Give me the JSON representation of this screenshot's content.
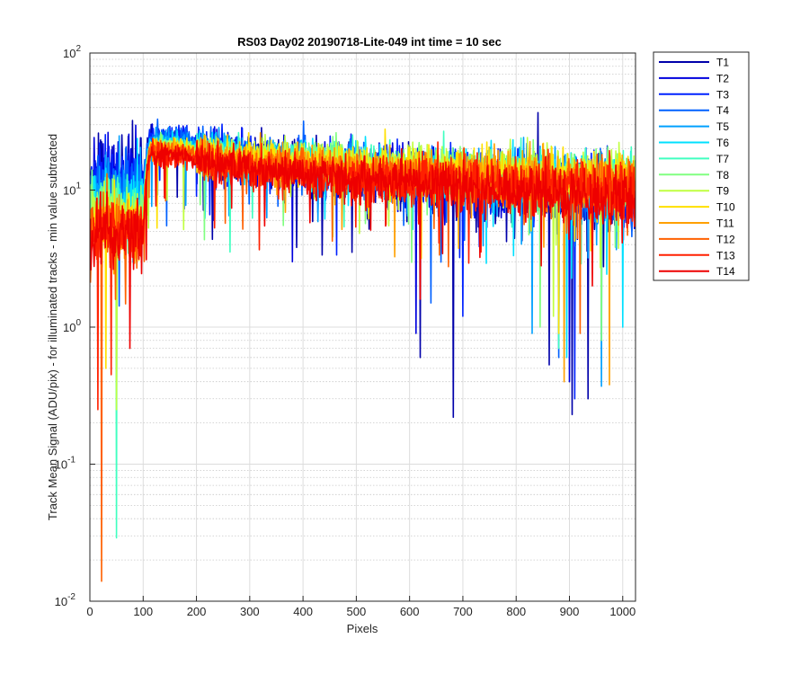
{
  "chart_data": {
    "type": "line",
    "title": "RS03 Day02 20190718-Lite-049 int time = 10 sec",
    "xlabel": "Pixels",
    "ylabel": "Track Mean Signal (ADU/pix) - for illuminated tracks - min value subtracted",
    "xlim": [
      0,
      1024
    ],
    "ylim": [
      0.01,
      100
    ],
    "yscale": "log",
    "x_ticks": [
      "0",
      "100",
      "200",
      "300",
      "400",
      "500",
      "600",
      "700",
      "800",
      "900",
      "1000"
    ],
    "y_ticks": [
      {
        "base": "10",
        "exp": "-2"
      },
      {
        "base": "10",
        "exp": "-1"
      },
      {
        "base": "10",
        "exp": "0"
      },
      {
        "base": "10",
        "exp": "1"
      },
      {
        "base": "10",
        "exp": "2"
      }
    ],
    "grid": true,
    "minor_grid": true,
    "legend_position": "outside-right",
    "series": [
      {
        "name": "T1",
        "color": "#0000aa",
        "profile": {
          "start": 11,
          "edge": 22,
          "mid": 12,
          "end": 8.5
        },
        "noise": 0.45,
        "dips": [
          [
            620,
            0.6
          ],
          [
            682,
            0.22
          ],
          [
            862,
            0.53
          ],
          [
            905,
            0.23
          ],
          [
            935,
            0.3
          ]
        ]
      },
      {
        "name": "T2",
        "color": "#0000dd",
        "profile": {
          "start": 12,
          "edge": 23,
          "mid": 13,
          "end": 9.0
        },
        "noise": 0.42,
        "dips": [
          [
            380,
            3.0
          ],
          [
            612,
            0.9
          ],
          [
            900,
            0.4
          ]
        ]
      },
      {
        "name": "T3",
        "color": "#0022ff",
        "profile": {
          "start": 11,
          "edge": 24,
          "mid": 14,
          "end": 9.5
        },
        "noise": 0.4,
        "dips": [
          [
            910,
            0.3
          ],
          [
            700,
            1.2
          ]
        ]
      },
      {
        "name": "T4",
        "color": "#0060ff",
        "profile": {
          "start": 10,
          "edge": 24,
          "mid": 15,
          "end": 10
        },
        "noise": 0.38,
        "dips": [
          [
            880,
            0.6
          ],
          [
            640,
            1.5
          ]
        ]
      },
      {
        "name": "T5",
        "color": "#00a0ff",
        "profile": {
          "start": 9,
          "edge": 23,
          "mid": 16,
          "end": 10.5
        },
        "noise": 0.36,
        "dips": [
          [
            960,
            0.37
          ],
          [
            830,
            0.9
          ]
        ]
      },
      {
        "name": "T6",
        "color": "#00e0ff",
        "profile": {
          "start": 8,
          "edge": 22,
          "mid": 17,
          "end": 11
        },
        "noise": 0.34,
        "dips": [
          [
            895,
            0.6
          ],
          [
            1000,
            1.0
          ]
        ]
      },
      {
        "name": "T7",
        "color": "#40ffc0",
        "profile": {
          "start": 7,
          "edge": 21,
          "mid": 17,
          "end": 11.5
        },
        "noise": 0.33,
        "dips": [
          [
            880,
            0.7
          ],
          [
            50,
            0.029
          ]
        ]
      },
      {
        "name": "T8",
        "color": "#80ff80",
        "profile": {
          "start": 7,
          "edge": 21,
          "mid": 17,
          "end": 12
        },
        "noise": 0.32,
        "dips": [
          [
            845,
            1.0
          ],
          [
            960,
            0.8
          ]
        ]
      },
      {
        "name": "T9",
        "color": "#c0ff40",
        "profile": {
          "start": 6,
          "edge": 20,
          "mid": 17,
          "end": 12.5
        },
        "noise": 0.32,
        "dips": [
          [
            50,
            0.25
          ],
          [
            870,
            1.2
          ]
        ]
      },
      {
        "name": "T10",
        "color": "#ffe000",
        "profile": {
          "start": 6,
          "edge": 20,
          "mid": 16,
          "end": 12
        },
        "noise": 0.33,
        "dips": [
          [
            30,
            0.5
          ],
          [
            880,
            0.9
          ]
        ]
      },
      {
        "name": "T11",
        "color": "#ffa000",
        "profile": {
          "start": 5,
          "edge": 19,
          "mid": 15,
          "end": 11
        },
        "noise": 0.34,
        "dips": [
          [
            890,
            0.4
          ],
          [
            975,
            0.38
          ]
        ]
      },
      {
        "name": "T12",
        "color": "#ff6000",
        "profile": {
          "start": 5,
          "edge": 19,
          "mid": 14,
          "end": 10
        },
        "noise": 0.35,
        "dips": [
          [
            22,
            0.014
          ],
          [
            920,
            0.9
          ]
        ]
      },
      {
        "name": "T13",
        "color": "#ff2000",
        "profile": {
          "start": 5,
          "edge": 18,
          "mid": 13,
          "end": 9.5
        },
        "noise": 0.36,
        "dips": [
          [
            40,
            0.45
          ],
          [
            15,
            0.25
          ]
        ]
      },
      {
        "name": "T14",
        "color": "#ee0000",
        "profile": {
          "start": 5,
          "edge": 18,
          "mid": 13,
          "end": 9
        },
        "noise": 0.34,
        "dips": [
          [
            75,
            0.7
          ],
          [
            620,
            1.6
          ]
        ]
      }
    ]
  }
}
